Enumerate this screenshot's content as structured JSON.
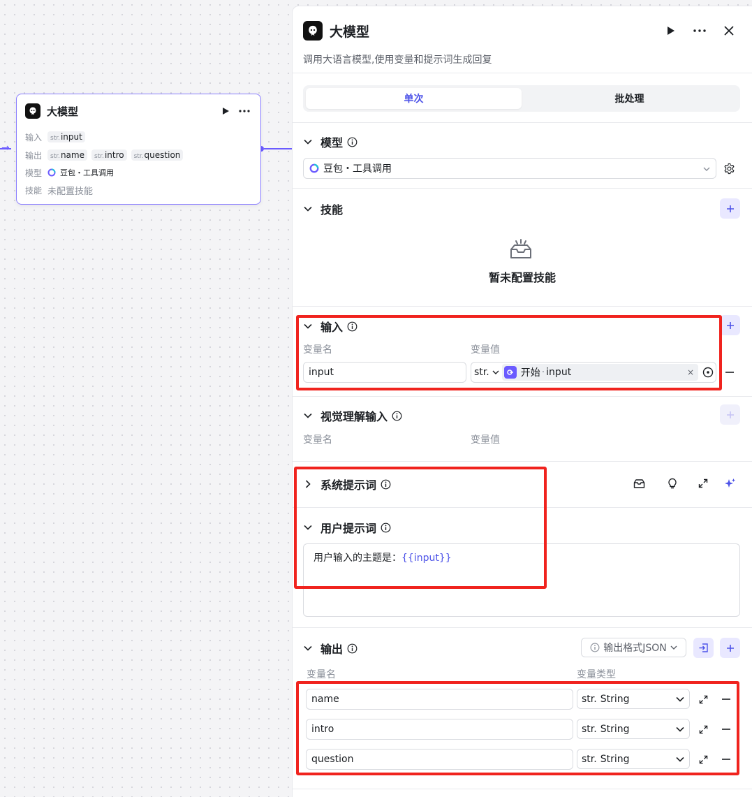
{
  "node": {
    "title": "大模型",
    "input_label": "输入",
    "inputs": [
      {
        "type": "str.",
        "name": "input"
      }
    ],
    "output_label": "输出",
    "outputs": [
      {
        "type": "str.",
        "name": "name"
      },
      {
        "type": "str.",
        "name": "intro"
      },
      {
        "type": "str.",
        "name": "question"
      }
    ],
    "model_label": "模型",
    "model_value": "豆包・工具调用",
    "skill_label": "技能",
    "skill_value": "未配置技能"
  },
  "panel": {
    "title": "大模型",
    "description": "调用大语言模型,使用变量和提示词生成回复",
    "tabs": [
      {
        "label": "单次",
        "active": true
      },
      {
        "label": "批处理",
        "active": false
      }
    ],
    "model_section": {
      "title": "模型",
      "selected": "豆包・工具调用"
    },
    "skills_section": {
      "title": "技能",
      "empty_text": "暂未配置技能"
    },
    "input_section": {
      "title": "输入",
      "col_name": "变量名",
      "col_value": "变量值",
      "rows": [
        {
          "name": "input",
          "type": "str.",
          "ref_node": "开始",
          "ref_sep": "·",
          "ref_var": "input"
        }
      ]
    },
    "vision_section": {
      "title": "视觉理解输入",
      "col_name": "变量名",
      "col_value": "变量值"
    },
    "system_prompt": {
      "title": "系统提示词"
    },
    "user_prompt": {
      "title": "用户提示词",
      "text": "用户输入的主题是：",
      "variable": "{{input}}"
    },
    "output_section": {
      "title": "输出",
      "format_label": "输出格式JSON",
      "col_name": "变量名",
      "col_type": "变量类型",
      "rows": [
        {
          "name": "name",
          "type_prefix": "str.",
          "type": "String"
        },
        {
          "name": "intro",
          "type_prefix": "str.",
          "type": "String"
        },
        {
          "name": "question",
          "type_prefix": "str.",
          "type": "String"
        }
      ]
    }
  },
  "colors": {
    "accent": "#4d53e8",
    "node_border": "#8b7eff",
    "highlight": "#f0231e"
  }
}
